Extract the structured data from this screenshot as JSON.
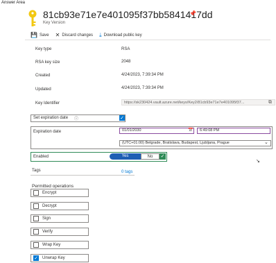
{
  "answer_area": "Answer Area",
  "header": {
    "title": "81cb93e71e7e401095f37bb5841417dd",
    "subtitle": "Key Version",
    "icons": [
      "key-icon",
      "pin-icon",
      "more-icon"
    ]
  },
  "toolbar": {
    "save": "Save",
    "discard": "Discard changes",
    "download": "Download public key"
  },
  "properties": {
    "key_type": {
      "label": "Key type",
      "value": "RSA"
    },
    "key_size": {
      "label": "RSA key size",
      "value": "2048"
    },
    "created": {
      "label": "Created",
      "value": "4/24/2023, 7:39:34 PM"
    },
    "updated": {
      "label": "Updated",
      "value": "4/24/2023, 7:39:34 PM"
    },
    "key_identifier": {
      "label": "Key Identifier",
      "value": "https://sk230424.vault.azure.net/keys/Key2/81cb93e71e7e401095f37..."
    }
  },
  "set_expiration": {
    "label": "Set expiration date",
    "checked": true
  },
  "expiration": {
    "label": "Expiration date",
    "date": "01/01/2030",
    "time": "6:49:08 PM",
    "timezone": "(UTC+01:00) Belgrade, Bratislava, Budapest, Ljubljana, Prague"
  },
  "enabled": {
    "label": "Enabled",
    "yes": "Yes",
    "no": "No",
    "value": "Yes"
  },
  "tags": {
    "label": "Tags",
    "link": "0 tags"
  },
  "permitted": {
    "heading": "Permitted operations",
    "ops": [
      {
        "label": "Encrypt",
        "checked": false
      },
      {
        "label": "Decrypt",
        "checked": false
      },
      {
        "label": "Sign",
        "checked": false
      },
      {
        "label": "Verify",
        "checked": false
      },
      {
        "label": "Wrap Key",
        "checked": false
      },
      {
        "label": "Unwrap Key",
        "checked": true
      }
    ]
  },
  "colors": {
    "accent": "#0078d4",
    "enabled_border": "#2e8b57",
    "toggle_on": "#1e5fb4"
  }
}
